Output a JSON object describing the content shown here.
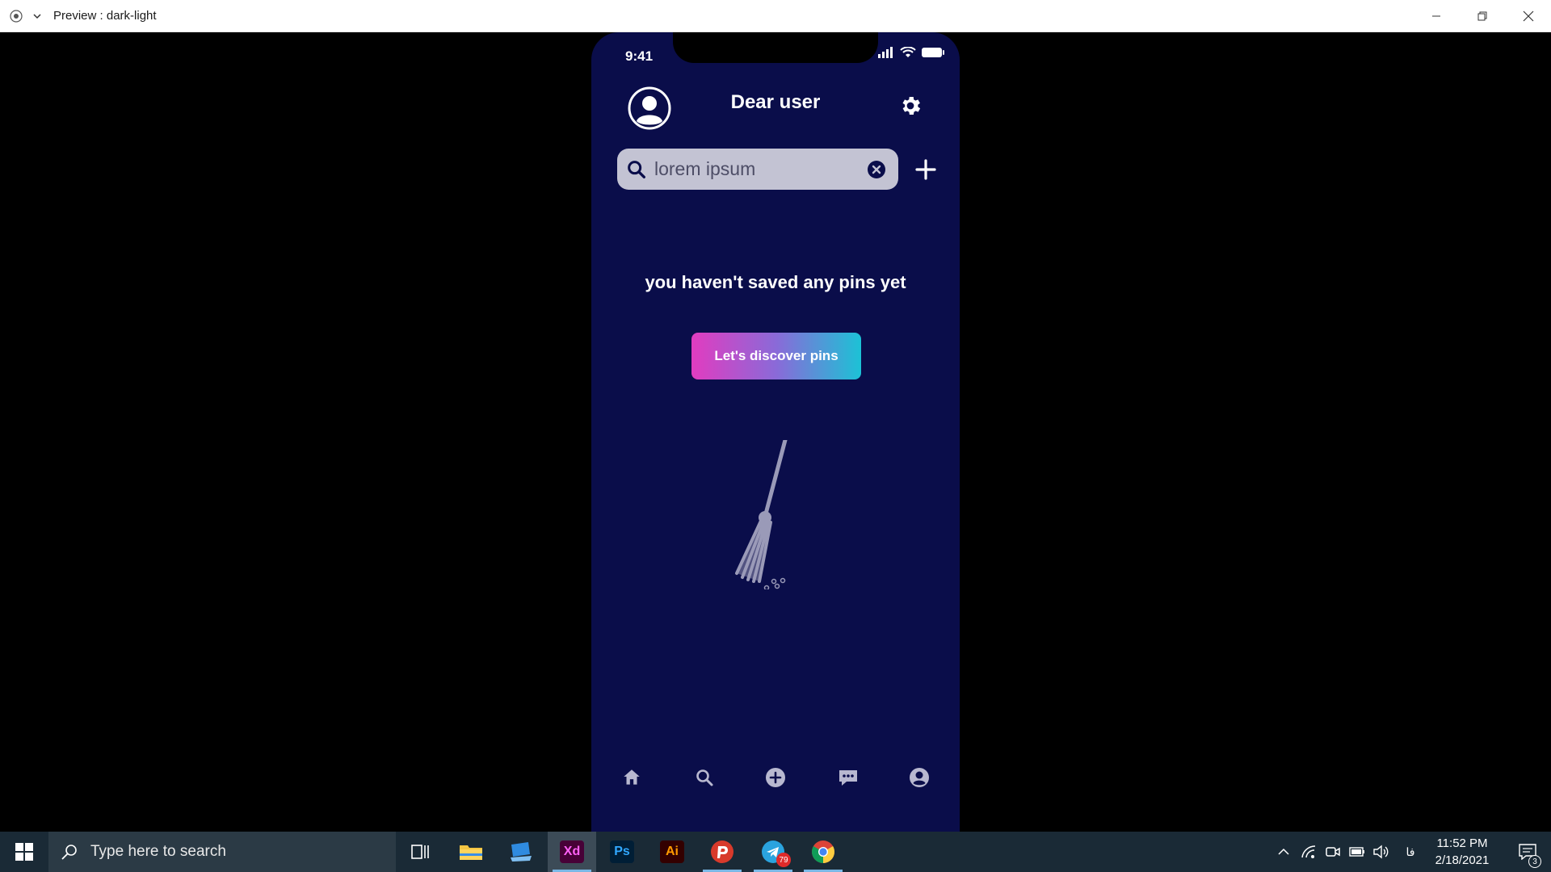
{
  "window": {
    "title": "Preview : dark-light"
  },
  "phone": {
    "status_time": "9:41",
    "header_title": "Dear user",
    "search": {
      "value": "lorem ipsum"
    },
    "empty_message": "you haven't saved any pins yet",
    "discover_button": "Let's discover pins",
    "bottom_nav": [
      "home-icon",
      "search-icon",
      "add-circle-icon",
      "chat-icon",
      "profile-icon"
    ],
    "colors": {
      "background": "#0a0d4a",
      "search_bg": "#c3c3d3",
      "button_gradient_start": "#e13cc0",
      "button_gradient_end": "#1cc2d6"
    }
  },
  "taskbar": {
    "search_placeholder": "Type here to search",
    "apps": [
      "task-view-icon",
      "file-explorer-icon",
      "remote-desktop-icon",
      "adobe-xd-icon",
      "photoshop-icon",
      "illustrator-icon",
      "psiphon-icon",
      "telegram-icon",
      "chrome-icon"
    ],
    "xd_label": "Xd",
    "ps_label": "Ps",
    "ai_label": "Ai",
    "telegram_badge": "79",
    "language": "فا",
    "clock_time": "11:52 PM",
    "clock_date": "2/18/2021",
    "notification_count": "3"
  }
}
